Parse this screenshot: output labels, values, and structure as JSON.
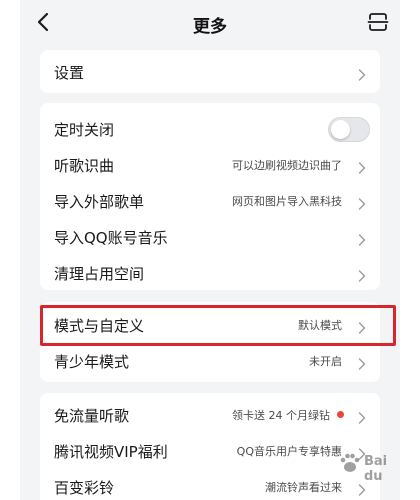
{
  "header": {
    "title": "更多",
    "back_icon": "chevron-left-icon",
    "right_icon": "scan-icon"
  },
  "sections": [
    {
      "items": [
        {
          "label": "设置",
          "chevron": true
        }
      ]
    },
    {
      "items": [
        {
          "label": "定时关闭",
          "control": "toggle",
          "toggle_on": false
        },
        {
          "label": "听歌识曲",
          "value": "可以边刷视频边识曲了",
          "chevron": true
        },
        {
          "label": "导入外部歌单",
          "value": "网页和图片导入黑科技",
          "chevron": true
        },
        {
          "label": "导入QQ账号音乐",
          "chevron": true
        },
        {
          "label": "清理占用空间",
          "chevron": true
        }
      ]
    },
    {
      "items": [
        {
          "label": "模式与自定义",
          "value": "默认模式",
          "chevron": true,
          "highlighted": true
        },
        {
          "label": "青少年模式",
          "value": "未开启",
          "chevron": true
        }
      ]
    },
    {
      "items": [
        {
          "label": "免流量听歌",
          "value": "领卡送 24 个月绿钻",
          "dot": true,
          "chevron": true
        },
        {
          "label": "腾讯视频VIP福利",
          "value": "QQ音乐用户专享特惠",
          "chevron": true
        },
        {
          "label": "百变彩铃",
          "value": "潮流铃声看过来",
          "chevron": true
        }
      ]
    }
  ],
  "watermark": {
    "text": "Bai du"
  },
  "colors": {
    "background": "#f3f4f6",
    "card": "#ffffff",
    "highlight_border": "#d9262c",
    "red_dot": "#e8453c",
    "toggle_off": "#e6e7ea"
  }
}
